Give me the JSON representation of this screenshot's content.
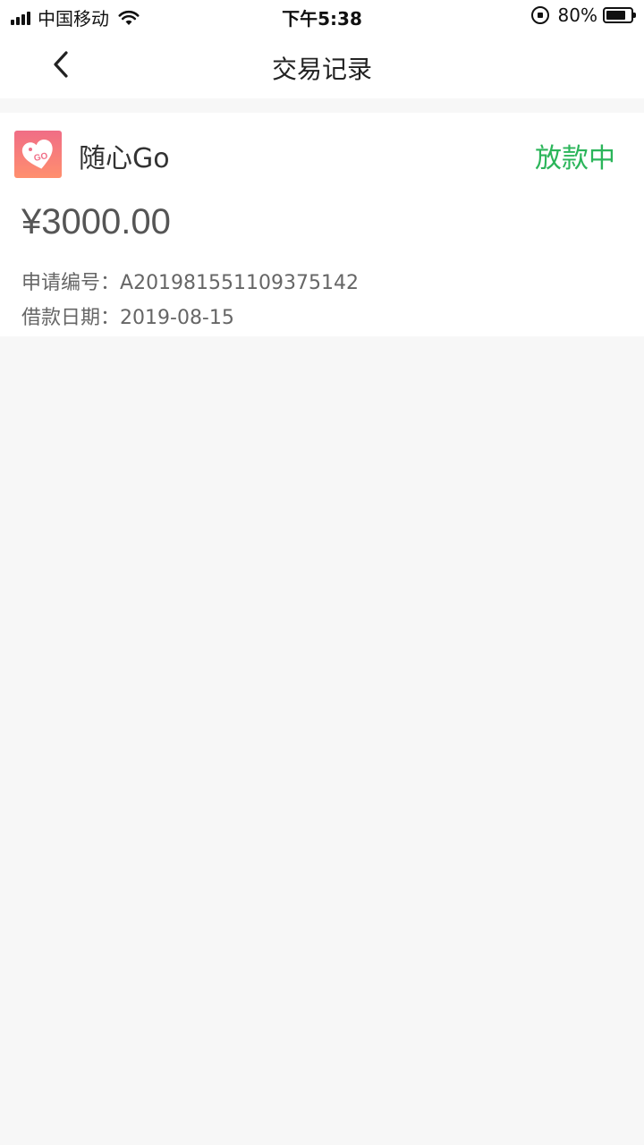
{
  "status_bar": {
    "carrier": "中国移动",
    "time": "下午5:38",
    "battery": "80%"
  },
  "nav": {
    "title": "交易记录",
    "back_icon": "chevron-left-icon"
  },
  "record": {
    "app_name": "随心Go",
    "logo_text": "GO",
    "status": "放款中",
    "amount": "¥3000.00",
    "apply_no_label": "申请编号：",
    "apply_no": "A201981551109375142",
    "date_label": "借款日期：",
    "date": "2019-08-15"
  },
  "colors": {
    "status_green": "#2bb55a",
    "logo_pink": "#f06d86",
    "background": "#f7f7f7"
  }
}
